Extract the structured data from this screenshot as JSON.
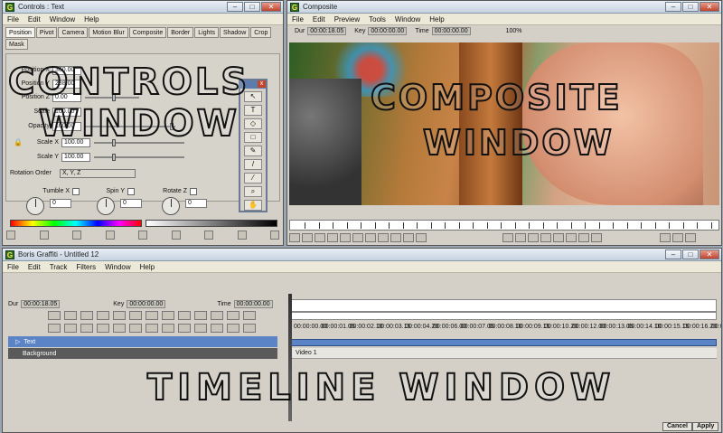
{
  "controls": {
    "title": "Controls : Text",
    "menu": [
      "File",
      "Edit",
      "Window",
      "Help"
    ],
    "tabs_row1": [
      "Position",
      "Pivot",
      "Camera",
      "Motion Blur",
      "Composite",
      "Border",
      "Lights",
      "Shadow"
    ],
    "tabs_row2": [
      "Crop",
      "Mask"
    ],
    "fields": [
      {
        "label": "Position X",
        "value": "360.00"
      },
      {
        "label": "Position Y",
        "value": "288.00"
      },
      {
        "label": "Position Z",
        "value": "0.00"
      },
      {
        "label": "Scale",
        "value": "100.00"
      },
      {
        "label": "Opacity",
        "value": "100.00"
      },
      {
        "label": "Scale X",
        "value": "100.00"
      },
      {
        "label": "Scale Y",
        "value": "100.00"
      }
    ],
    "rotation_order_label": "Rotation Order",
    "rotation_order_value": "X, Y, Z",
    "tumble_label": "Tumble X",
    "spin_label": "Spin Y",
    "rotate_label": "Rotate Z",
    "dial_values": [
      "0",
      "0",
      "0"
    ],
    "overlay_line1": "CONTROLS",
    "overlay_line2": "WINDOW"
  },
  "composite": {
    "title": "Composite",
    "menu": [
      "File",
      "Edit",
      "Preview",
      "Tools",
      "Window",
      "Help"
    ],
    "dur_label": "Dur",
    "dur_value": "00:00:18.05",
    "key_label": "Key",
    "key_value": "00:00:00.00",
    "time_label": "Time",
    "time_value": "00:00:00.00",
    "zoom": "100%",
    "overlay_line1": "COMPOSITE",
    "overlay_line2": "WINDOW"
  },
  "timeline": {
    "title": "Boris Graffiti - Untitled 12",
    "menu": [
      "File",
      "Edit",
      "Track",
      "Filters",
      "Window",
      "Help"
    ],
    "dur_label": "Dur",
    "dur_value": "00:00:18.05",
    "key_label": "Key",
    "key_value": "00:00:00.00",
    "time_label": "Time",
    "time_value": "00:00:00.00",
    "ruler_times": [
      "00:00:00.00",
      "00:00:01.05",
      "00:00:02.10",
      "00:00:03.15",
      "00:00:04.20",
      "00:00:06.00",
      "00:00:07.05",
      "00:00:08.10",
      "00:00:09.15",
      "00:00:10.20",
      "00:00:12.00",
      "00:00:13.05",
      "00:00:14.10",
      "00:00:15.15",
      "00:00:16.20",
      "00:00"
    ],
    "tracks": [
      {
        "name": "Text",
        "selected": true
      },
      {
        "name": "Background",
        "selected": false
      }
    ],
    "video_label": "Video 1",
    "cancel_label": "Cancel",
    "apply_label": "Apply",
    "overlay_text": "TIMELINE WINDOW"
  },
  "colors": {
    "selection_blue": "#5b84c7",
    "window_gray": "#d4d0c8",
    "track_dark": "#5a5a5a"
  }
}
